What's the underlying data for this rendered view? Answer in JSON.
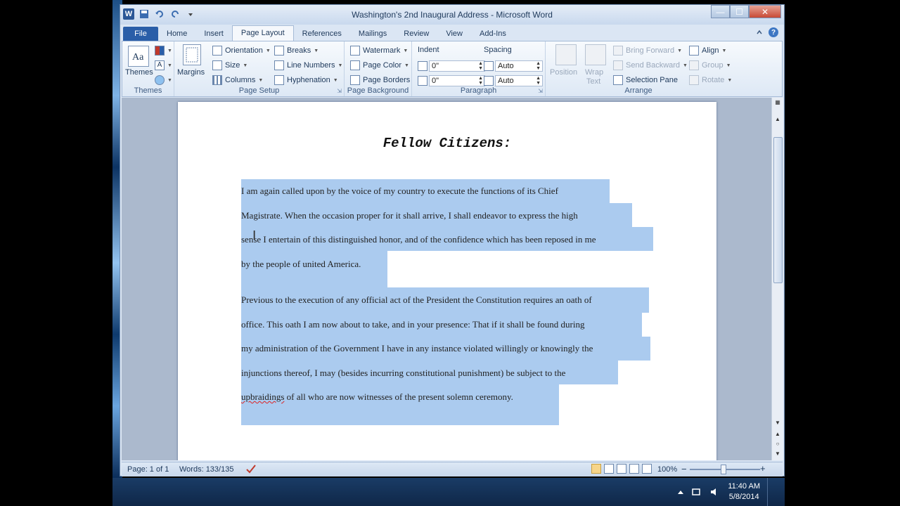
{
  "window": {
    "title": "Washington's 2nd Inaugural Address - Microsoft Word",
    "app_icon": "W",
    "controls": {
      "minimize": "—",
      "maximize": "☐",
      "close": "✕"
    }
  },
  "tabs": [
    "File",
    "Home",
    "Insert",
    "Page Layout",
    "References",
    "Mailings",
    "Review",
    "View",
    "Add-Ins"
  ],
  "active_tab": "Page Layout",
  "ribbon": {
    "themes": {
      "button": "Themes",
      "group": "Themes"
    },
    "page_setup": {
      "margins": "Margins",
      "orientation": "Orientation",
      "size": "Size",
      "columns": "Columns",
      "breaks": "Breaks",
      "line_numbers": "Line Numbers",
      "hyphenation": "Hyphenation",
      "group": "Page Setup"
    },
    "page_background": {
      "watermark": "Watermark",
      "page_color": "Page Color",
      "page_borders": "Page Borders",
      "group": "Page Background"
    },
    "paragraph": {
      "indent_label": "Indent",
      "spacing_label": "Spacing",
      "indent_left": "0\"",
      "indent_right": "0\"",
      "spacing_before": "Auto",
      "spacing_after": "Auto",
      "group": "Paragraph"
    },
    "arrange": {
      "position": "Position",
      "wrap_text_1": "Wrap",
      "wrap_text_2": "Text",
      "bring_forward": "Bring Forward",
      "send_backward": "Send Backward",
      "selection_pane": "Selection Pane",
      "align": "Align",
      "group_btn": "Group",
      "rotate": "Rotate",
      "group": "Arrange"
    }
  },
  "document": {
    "heading": "Fellow Citizens:",
    "paragraph1_lines": [
      "I am again called upon by the voice of my country to execute the functions of its Chief",
      "Magistrate. When the occasion proper for it shall arrive, I shall endeavor to express the high",
      "sense I entertain of this distinguished honor, and of the confidence which has been reposed in me",
      "by the people of united America."
    ],
    "paragraph2_lines": [
      "Previous to the execution of any official act of the President the Constitution requires an oath of",
      "office. This oath I am now about to take, and in your presence: That if it shall be found during",
      "my administration of the Government I have in any instance violated willingly or knowingly the",
      "injunctions thereof, I may (besides incurring constitutional punishment) be subject to the"
    ],
    "paragraph2_last_misspelled": "upbraidings",
    "paragraph2_last_rest": " of all who are now witnesses of the present solemn ceremony."
  },
  "status": {
    "page": "Page: 1 of 1",
    "words": "Words: 133/135",
    "zoom": "100%",
    "zoom_minus": "−",
    "zoom_plus": "+"
  },
  "taskbar": {
    "time": "11:40 AM",
    "date": "5/8/2014"
  },
  "colors": {
    "selection": "#abcbef",
    "file_tab": "#2a5ea8",
    "titlebar": "#c9d9ee"
  }
}
